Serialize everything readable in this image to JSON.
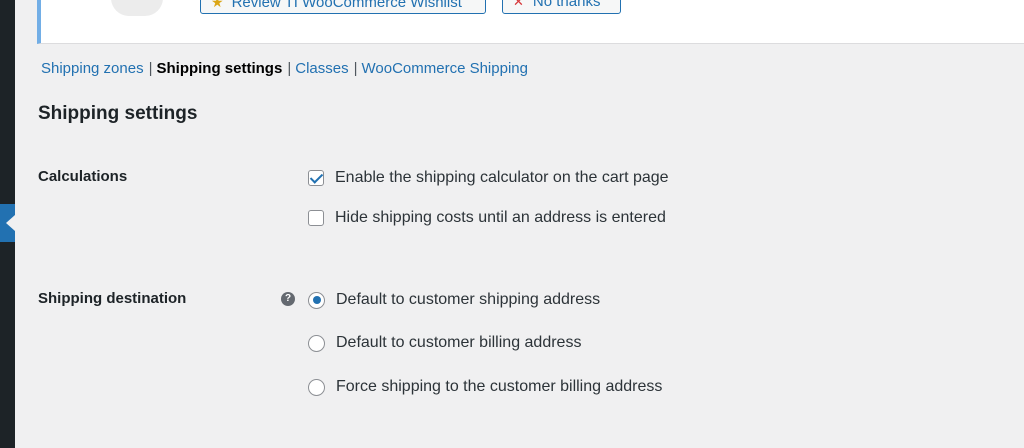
{
  "notice": {
    "review_label": "Review TI WooCommerce Wishlist",
    "no_thanks_label": "No thanks",
    "review_icon": "star-icon",
    "no_thanks_icon": "close-icon"
  },
  "subnav": [
    {
      "label": "Shipping zones",
      "current": false
    },
    {
      "label": "Shipping settings",
      "current": true
    },
    {
      "label": "Classes",
      "current": false
    },
    {
      "label": "WooCommerce Shipping",
      "current": false
    }
  ],
  "separator": "|",
  "page_title": "Shipping settings",
  "calculations": {
    "label": "Calculations",
    "options": [
      {
        "label": "Enable the shipping calculator on the cart page",
        "checked": true
      },
      {
        "label": "Hide shipping costs until an address is entered",
        "checked": false
      }
    ]
  },
  "destination": {
    "label": "Shipping destination",
    "help_icon": "?",
    "options": [
      {
        "label": "Default to customer shipping address",
        "selected": true
      },
      {
        "label": "Default to customer billing address",
        "selected": false
      },
      {
        "label": "Force shipping to the customer billing address",
        "selected": false
      }
    ]
  },
  "colors": {
    "accent": "#2271b1",
    "sidebar": "#1d2327",
    "background": "#f0f0f1"
  }
}
